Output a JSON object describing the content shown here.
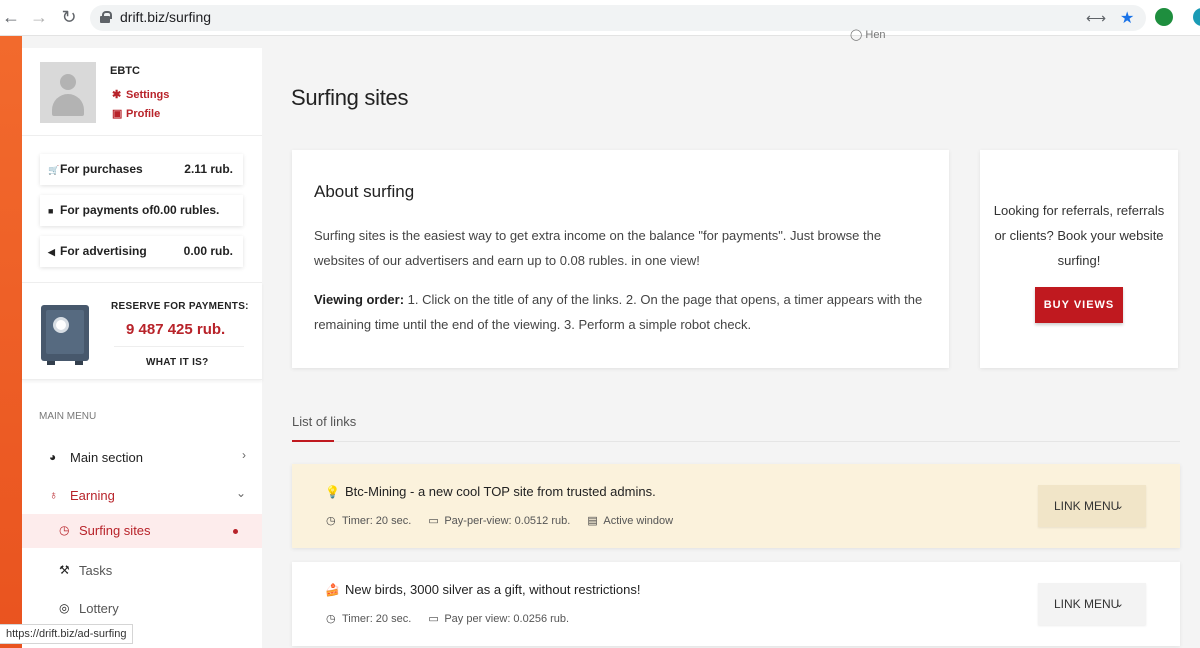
{
  "browser": {
    "url": "drift.biz/surfing",
    "status_url": "https://drift.biz/ad-surfing"
  },
  "top_hint": "Hen",
  "profile": {
    "username": "EBTC",
    "settings": "Settings",
    "profile": "Profile"
  },
  "balances": [
    {
      "label": "For purchases",
      "value": "2.11 rub."
    },
    {
      "label": "For payments of",
      "value": "0.00 rubles."
    },
    {
      "label": "For advertising",
      "value": "0.00 rub."
    }
  ],
  "reserve": {
    "label": "RESERVE FOR PAYMENTS:",
    "value": "9 487 425 rub.",
    "what": "WHAT IT IS?"
  },
  "menu": {
    "title": "MAIN MENU",
    "items": [
      {
        "label": "Main section"
      },
      {
        "label": "Earning"
      },
      {
        "label": "Surfing sites"
      },
      {
        "label": "Tasks"
      },
      {
        "label": "Lottery"
      }
    ]
  },
  "page": {
    "title": "Surfing sites"
  },
  "about": {
    "title": "About surfing",
    "p1": "Surfing sites is the easiest way to get extra income on the balance \"for payments\". Just browse the websites of our advertisers and earn up to 0.08 rubles. in one view!",
    "p2_bold": "Viewing order:",
    "p2": " 1. Click on the title of any of the links. 2. On the page that opens, a timer appears with the remaining time until the end of the viewing. 3. Perform a simple robot check."
  },
  "buy": {
    "text": "Looking for referrals, referrals or clients? Book your website surfing!",
    "button": "BUY VIEWS"
  },
  "links_tab": "List of links",
  "links": [
    {
      "emoji": "💡",
      "title": "Btc-Mining - a new cool TOP site from trusted admins.",
      "timer": "Timer: 20 sec.",
      "pay": "Pay-per-view: 0.0512 rub.",
      "window": "Active window",
      "menu": "LINK MENU"
    },
    {
      "emoji": "🍰",
      "title": "New birds, 3000 silver as a gift, without restrictions!",
      "timer": "Timer: 20 sec.",
      "pay": "Pay per view: 0.0256 rub.",
      "menu": "LINK MENU"
    }
  ],
  "colors": {
    "accent": "#c0191f",
    "sidebar_strip": "#f26a2d",
    "highlight_card": "#fbf2dc"
  }
}
